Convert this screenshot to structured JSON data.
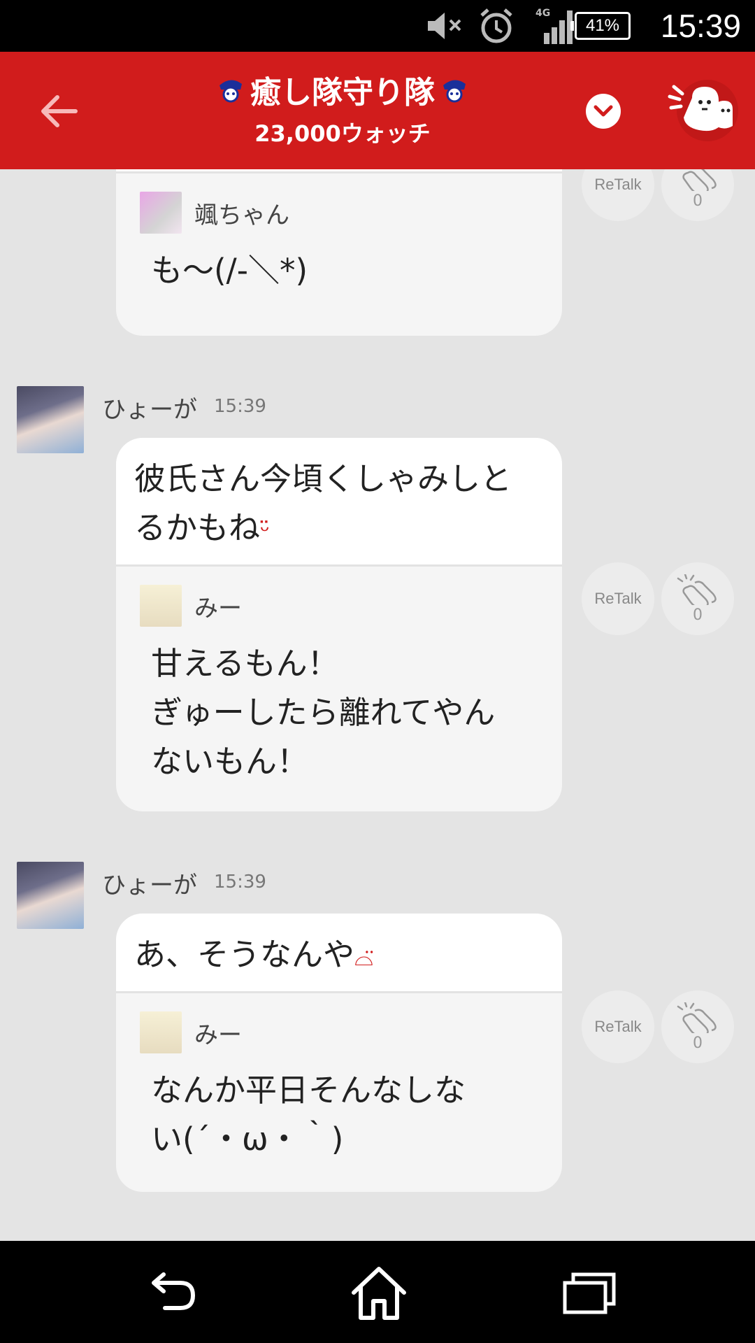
{
  "status_bar": {
    "time": "15:39",
    "battery": "41%",
    "network": "4G",
    "icons": [
      "mute-icon",
      "alarm-icon",
      "signal-icon",
      "battery-icon"
    ]
  },
  "header": {
    "title": "癒し隊守り隊",
    "watch_count": "23,000ウォッチ",
    "accent_color": "#d11c1c"
  },
  "messages": [
    {
      "quote": {
        "name": "颯ちゃん",
        "text": "も〜(/-＼*)"
      },
      "retalk_label": "ReTalk",
      "clap_count": "0"
    },
    {
      "user": "ひょーが",
      "time": "15:39",
      "text": "彼氏さん今頃くしゃみしとるかもね",
      "emoji": "tongue-face-emoji",
      "quote": {
        "name": "みー",
        "text": "甘えるもん！\nぎゅーしたら離れてやん\nないもん！"
      },
      "retalk_label": "ReTalk",
      "clap_count": "0"
    },
    {
      "user": "ひょーが",
      "time": "15:39",
      "text": "あ、そうなんや",
      "emoji": "sad-face-emoji",
      "quote": {
        "name": "みー",
        "text": "なんか平日そんなしな\nい(´・ω・｀)"
      },
      "retalk_label": "ReTalk",
      "clap_count": "0"
    }
  ]
}
